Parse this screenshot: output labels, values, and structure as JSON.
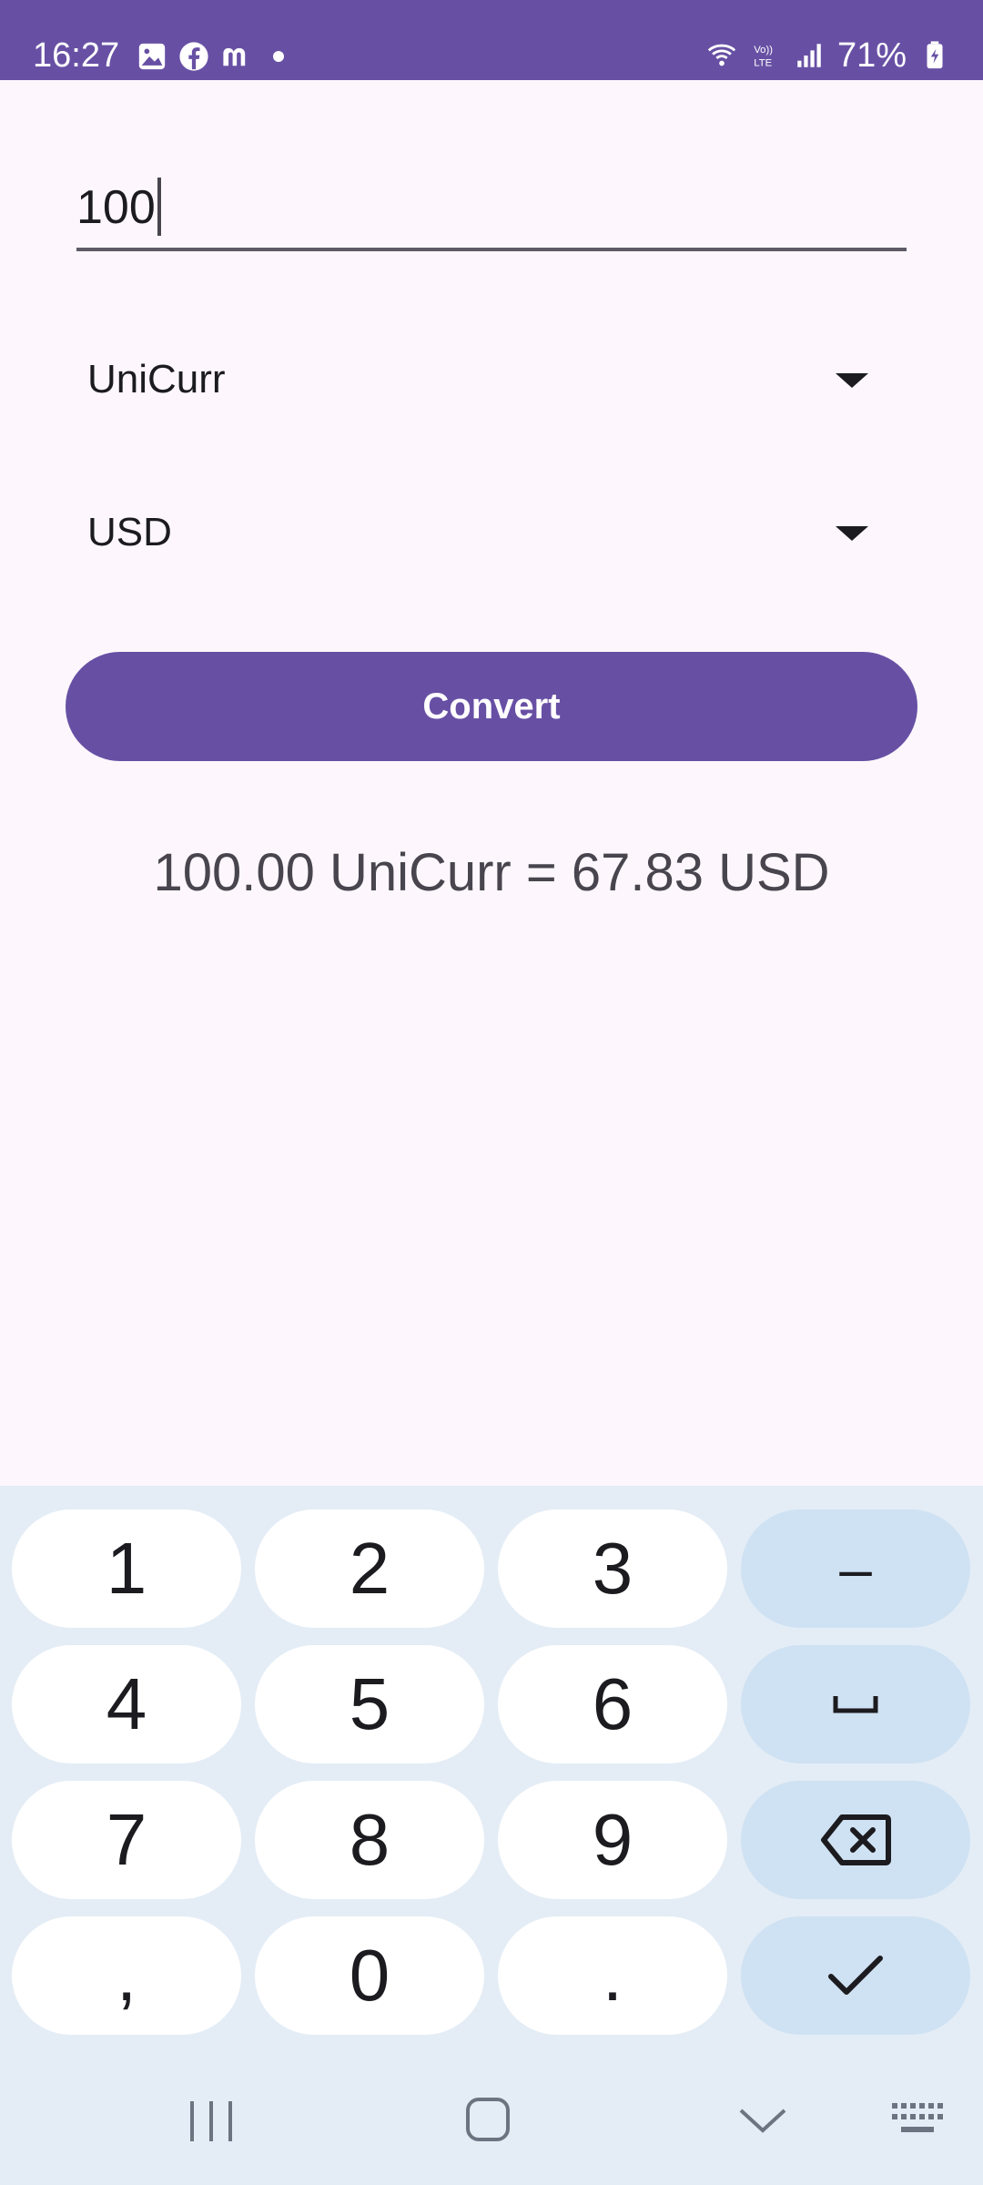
{
  "status_bar": {
    "time": "16:27",
    "left_icons": [
      "gallery-icon",
      "facebook-icon",
      "m-app-icon",
      "dot-icon"
    ],
    "right_icons": [
      "wifi-icon",
      "volte-icon",
      "signal-icon",
      "battery-icon"
    ],
    "battery": "71%",
    "color": "#6750a4"
  },
  "form": {
    "amount_value": "100",
    "from_currency": "UniCurr",
    "to_currency": "USD",
    "convert_label": "Convert",
    "result_text": "100.00 UniCurr = 67.83 USD"
  },
  "keyboard": {
    "rows": [
      [
        "1",
        "2",
        "3",
        "-"
      ],
      [
        "4",
        "5",
        "6",
        "space"
      ],
      [
        "7",
        "8",
        "9",
        "backspace"
      ],
      [
        ",",
        "0",
        ".",
        "done"
      ]
    ],
    "labels": {
      "k1": "1",
      "k2": "2",
      "k3": "3",
      "minus": "–",
      "k4": "4",
      "k5": "5",
      "k6": "6",
      "k7": "7",
      "k8": "8",
      "k9": "9",
      "comma": ",",
      "k0": "0",
      "dot": "."
    }
  },
  "nav_bar": {
    "icons": [
      "recent-apps-icon",
      "home-icon",
      "back-icon",
      "keyboard-switch-icon"
    ]
  },
  "colors": {
    "primary": "#6750a4",
    "background": "#fdf7fd",
    "keyboard_bg": "#e4edf6",
    "func_key": "#cfe2f3"
  }
}
